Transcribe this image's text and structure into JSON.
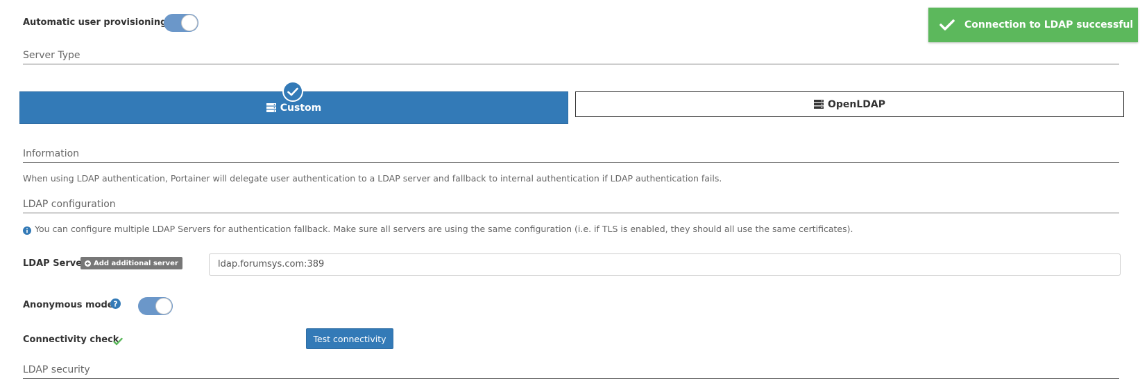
{
  "top_clipped_text": "",
  "auto_provisioning": {
    "label": "Automatic user provisioning",
    "enabled": true
  },
  "toast": {
    "message": "Connection to LDAP successful",
    "color": "#5cb85c"
  },
  "server_type": {
    "title": "Server Type",
    "options": [
      {
        "label": "Custom",
        "selected": true,
        "icon": "server-icon"
      },
      {
        "label": "OpenLDAP",
        "selected": false,
        "icon": "server-icon"
      }
    ]
  },
  "information": {
    "title": "Information",
    "text": "When using LDAP authentication, Portainer will delegate user authentication to a LDAP server and fallback to internal authentication if LDAP authentication fails."
  },
  "ldap_configuration": {
    "title": "LDAP configuration",
    "info": "You can configure multiple LDAP Servers for authentication fallback. Make sure all servers are using the same configuration (i.e. if TLS is enabled, they should all use the same certificates).",
    "server_label": "LDAP Server",
    "add_server_label": "Add additional server",
    "server_value": "ldap.forumsys.com:389",
    "anonymous_label": "Anonymous mode",
    "anonymous_enabled": true,
    "connectivity_label": "Connectivity check",
    "connectivity_ok": true,
    "test_button": "Test connectivity"
  },
  "ldap_security": {
    "title": "LDAP security"
  },
  "colors": {
    "primary": "#337ab7",
    "success": "#5cb85c",
    "toggle": "#6b97c9"
  }
}
